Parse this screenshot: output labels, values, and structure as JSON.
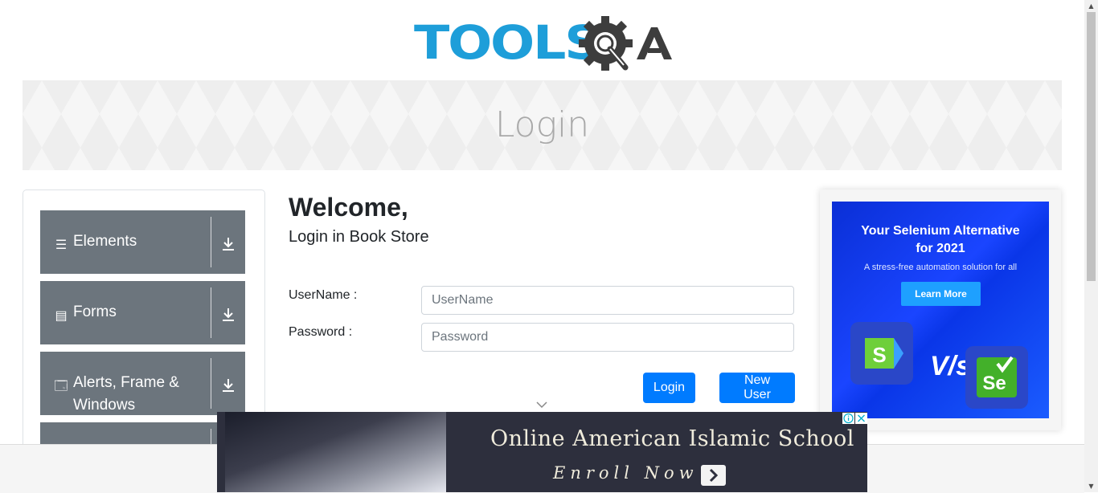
{
  "logo": {
    "text_part": "TOOLS",
    "icon": "gear-magnifier-icon",
    "suffix": "QA"
  },
  "banner": {
    "title": "Login"
  },
  "sidebar": {
    "groups": [
      {
        "label": "Elements",
        "icon": "hamburger-icon"
      },
      {
        "label": "Forms",
        "icon": "document-icon"
      },
      {
        "label": "Alerts, Frame &",
        "label2": "Windows",
        "icon": "window-icon"
      },
      {
        "label": "",
        "icon": ""
      }
    ]
  },
  "form": {
    "heading": "Welcome,",
    "subheading": "Login in Book Store",
    "username_label": "UserName :",
    "username_placeholder": "UserName",
    "password_label": "Password :",
    "password_placeholder": "Password",
    "login_button": "Login",
    "new_user_button": "New User"
  },
  "right_ad": {
    "headline1": "Your Selenium Alternative",
    "headline2": "for 2021",
    "tagline": "A stress-free automation solution for all",
    "cta": "Learn More",
    "versus": "V/s",
    "tile_left_letter": "S",
    "tile_right_letter": "Se"
  },
  "bottom_ad": {
    "headline": "Online American Islamic School",
    "cta": "Enroll Now"
  },
  "colors": {
    "brand_blue": "#1e9ed9",
    "primary_button": "#007bff",
    "sidebar_group": "#6c757d"
  }
}
